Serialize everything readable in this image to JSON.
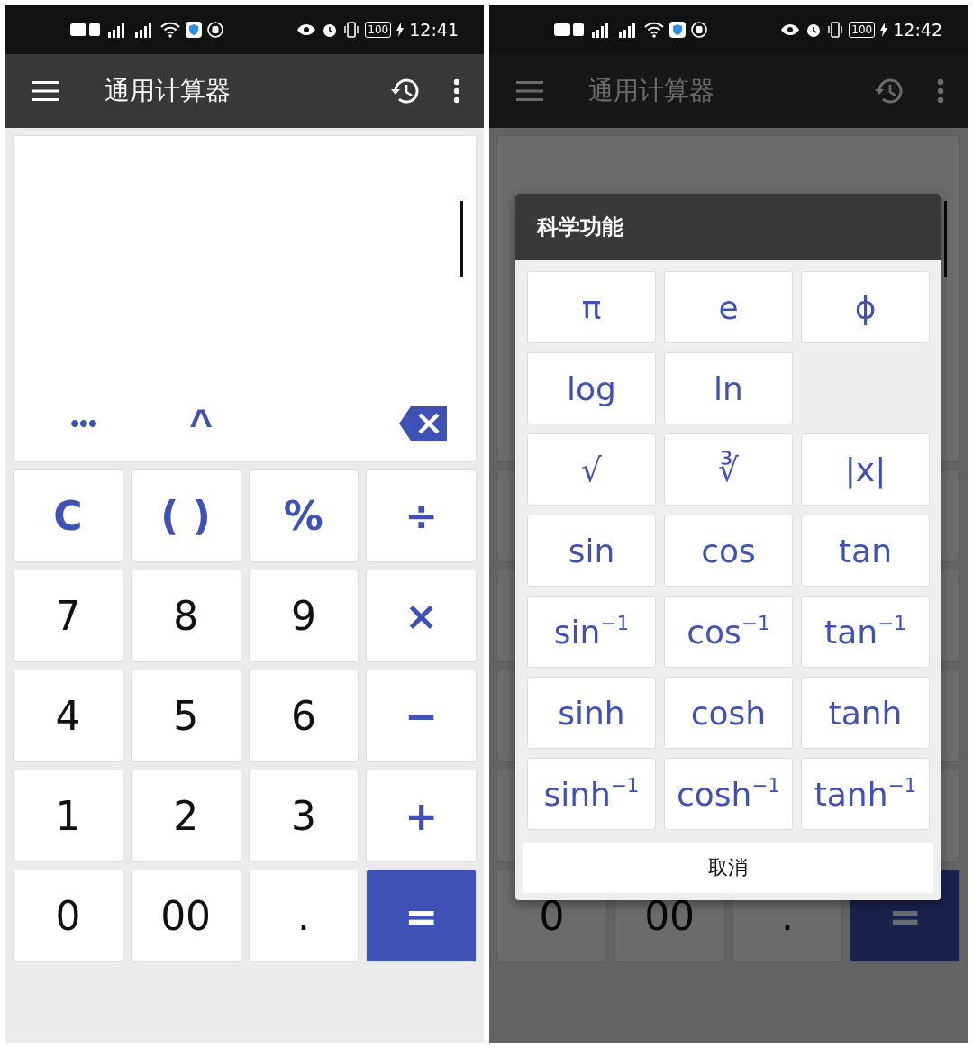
{
  "left_screen": {
    "status_bar": {
      "battery": "100",
      "time": "12:41"
    },
    "app_bar": {
      "title": "通用计算器"
    },
    "display": {
      "toolbar": [
        "•••",
        "^"
      ]
    },
    "keypad": [
      [
        {
          "label": "C",
          "kind": "operator"
        },
        {
          "label": "( )",
          "kind": "operator"
        },
        {
          "label": "%",
          "kind": "operator"
        },
        {
          "label": "÷",
          "kind": "operator"
        }
      ],
      [
        {
          "label": "7",
          "kind": "digit"
        },
        {
          "label": "8",
          "kind": "digit"
        },
        {
          "label": "9",
          "kind": "digit"
        },
        {
          "label": "×",
          "kind": "operator"
        }
      ],
      [
        {
          "label": "4",
          "kind": "digit"
        },
        {
          "label": "5",
          "kind": "digit"
        },
        {
          "label": "6",
          "kind": "digit"
        },
        {
          "label": "−",
          "kind": "operator"
        }
      ],
      [
        {
          "label": "1",
          "kind": "digit"
        },
        {
          "label": "2",
          "kind": "digit"
        },
        {
          "label": "3",
          "kind": "digit"
        },
        {
          "label": "+",
          "kind": "operator"
        }
      ],
      [
        {
          "label": "0",
          "kind": "digit"
        },
        {
          "label": "00",
          "kind": "digit"
        },
        {
          "label": ".",
          "kind": "digit"
        },
        {
          "label": "=",
          "kind": "equals"
        }
      ]
    ]
  },
  "right_screen": {
    "status_bar": {
      "battery": "100",
      "time": "12:42"
    },
    "app_bar": {
      "title": "通用计算器"
    },
    "keypad_bottom_row": [
      {
        "label": "0",
        "kind": "digit"
      },
      {
        "label": "00",
        "kind": "digit"
      },
      {
        "label": ".",
        "kind": "digit"
      },
      {
        "label": "=",
        "kind": "equals"
      }
    ],
    "dialog": {
      "title": "科学功能",
      "keys": [
        {
          "label": "π",
          "kind": "key"
        },
        {
          "label": "e",
          "kind": "key"
        },
        {
          "label": "ϕ",
          "kind": "key"
        },
        {
          "label": "log",
          "kind": "key"
        },
        {
          "label": "ln",
          "kind": "key"
        },
        {
          "kind": "empty"
        },
        {
          "label": "√",
          "kind": "key"
        },
        {
          "label": "∛",
          "kind": "key"
        },
        {
          "label": "|x|",
          "kind": "key"
        },
        {
          "label": "sin",
          "kind": "key"
        },
        {
          "label": "cos",
          "kind": "key"
        },
        {
          "label": "tan",
          "kind": "key"
        },
        {
          "label": "sin$^{−1}$",
          "kind": "key"
        },
        {
          "label": "cos$^{−1}$",
          "kind": "key"
        },
        {
          "label": "tan$^{−1}$",
          "kind": "key"
        },
        {
          "label": "sinh",
          "kind": "key"
        },
        {
          "label": "cosh",
          "kind": "key"
        },
        {
          "label": "tanh",
          "kind": "key"
        },
        {
          "label": "sinh$^{−1}$",
          "kind": "key"
        },
        {
          "label": "cosh$^{−1}$",
          "kind": "key"
        },
        {
          "label": "tanh$^{−1}$",
          "kind": "key"
        }
      ],
      "cancel": "取消"
    }
  }
}
